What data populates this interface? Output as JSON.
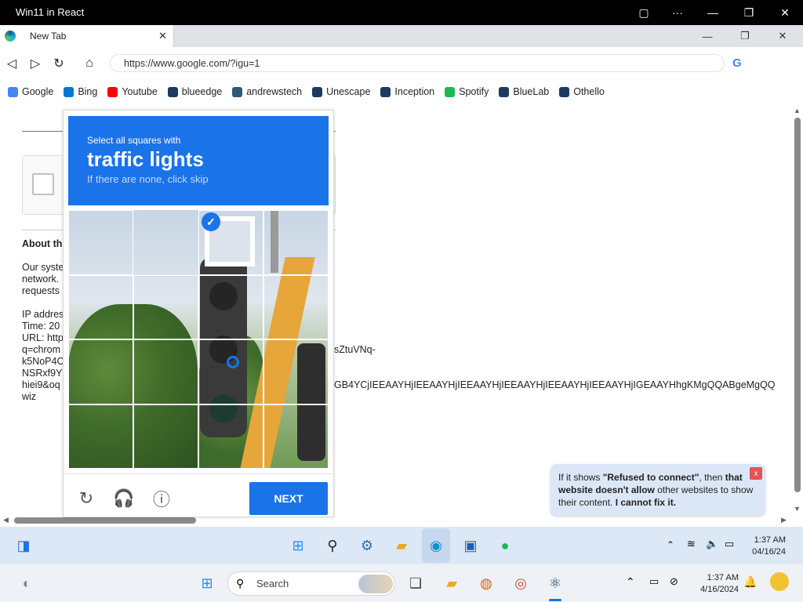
{
  "window": {
    "title": "Win11 in React"
  },
  "tab": {
    "label": "New Tab",
    "close": "✕"
  },
  "address": {
    "url": "https://www.google.com/?igu=1"
  },
  "bookmarks": [
    {
      "label": "Google",
      "color": "#4285f4"
    },
    {
      "label": "Bing",
      "color": "#0078d4"
    },
    {
      "label": "Youtube",
      "color": "#ff0000"
    },
    {
      "label": "blueedge",
      "color": "#1e3a5f"
    },
    {
      "label": "andrewstech",
      "color": "#2c5a7a"
    },
    {
      "label": "Unescape",
      "color": "#1e3a5f"
    },
    {
      "label": "Inception",
      "color": "#1e3a5f"
    },
    {
      "label": "Spotify",
      "color": "#1db954"
    },
    {
      "label": "BlueLab",
      "color": "#1e3a5f"
    },
    {
      "label": "Othello",
      "color": "#1e3a5f"
    }
  ],
  "page": {
    "about_heading": "About th",
    "lines1": [
      "Our syste",
      "network.",
      "requests"
    ],
    "lines2": [
      "IP addres",
      "Time: 20",
      "URL: http",
      "q=chrom",
      "k5NoP4C",
      "NSRxf9Y",
      "hiei9&oq",
      "wiz"
    ],
    "url_tail1": "sZtuVNq-",
    "url_tail2": "GB4YCjIEEAAYHjIEEAAYHjIEEAAYHjIEEAAYHjIEEAAYHjIEEAAYHjIGEAAYHhgKMgQQABgeMgQQ"
  },
  "captcha": {
    "instruction": "Select all squares with",
    "target": "traffic lights",
    "hint": "If there are none, click skip",
    "next_label": "NEXT",
    "selected_cells": [
      1
    ]
  },
  "toast": {
    "part1": "If it shows ",
    "bold1": "\"Refused to connect\"",
    "part2": ", then ",
    "bold2": "that website doesn't allow",
    "part3": " other websites to show their content. ",
    "bold3": "I cannot fix it.",
    "close": "x"
  },
  "taskbar_top": {
    "time": "1:37 AM",
    "date": "04/16/24"
  },
  "taskbar_bottom": {
    "search_placeholder": "Search",
    "time": "1:37 AM",
    "date": "4/16/2024"
  },
  "colors": {
    "accent": "#1a73e8",
    "titlebar": "#000000",
    "toast_bg": "#dbe7f7"
  }
}
